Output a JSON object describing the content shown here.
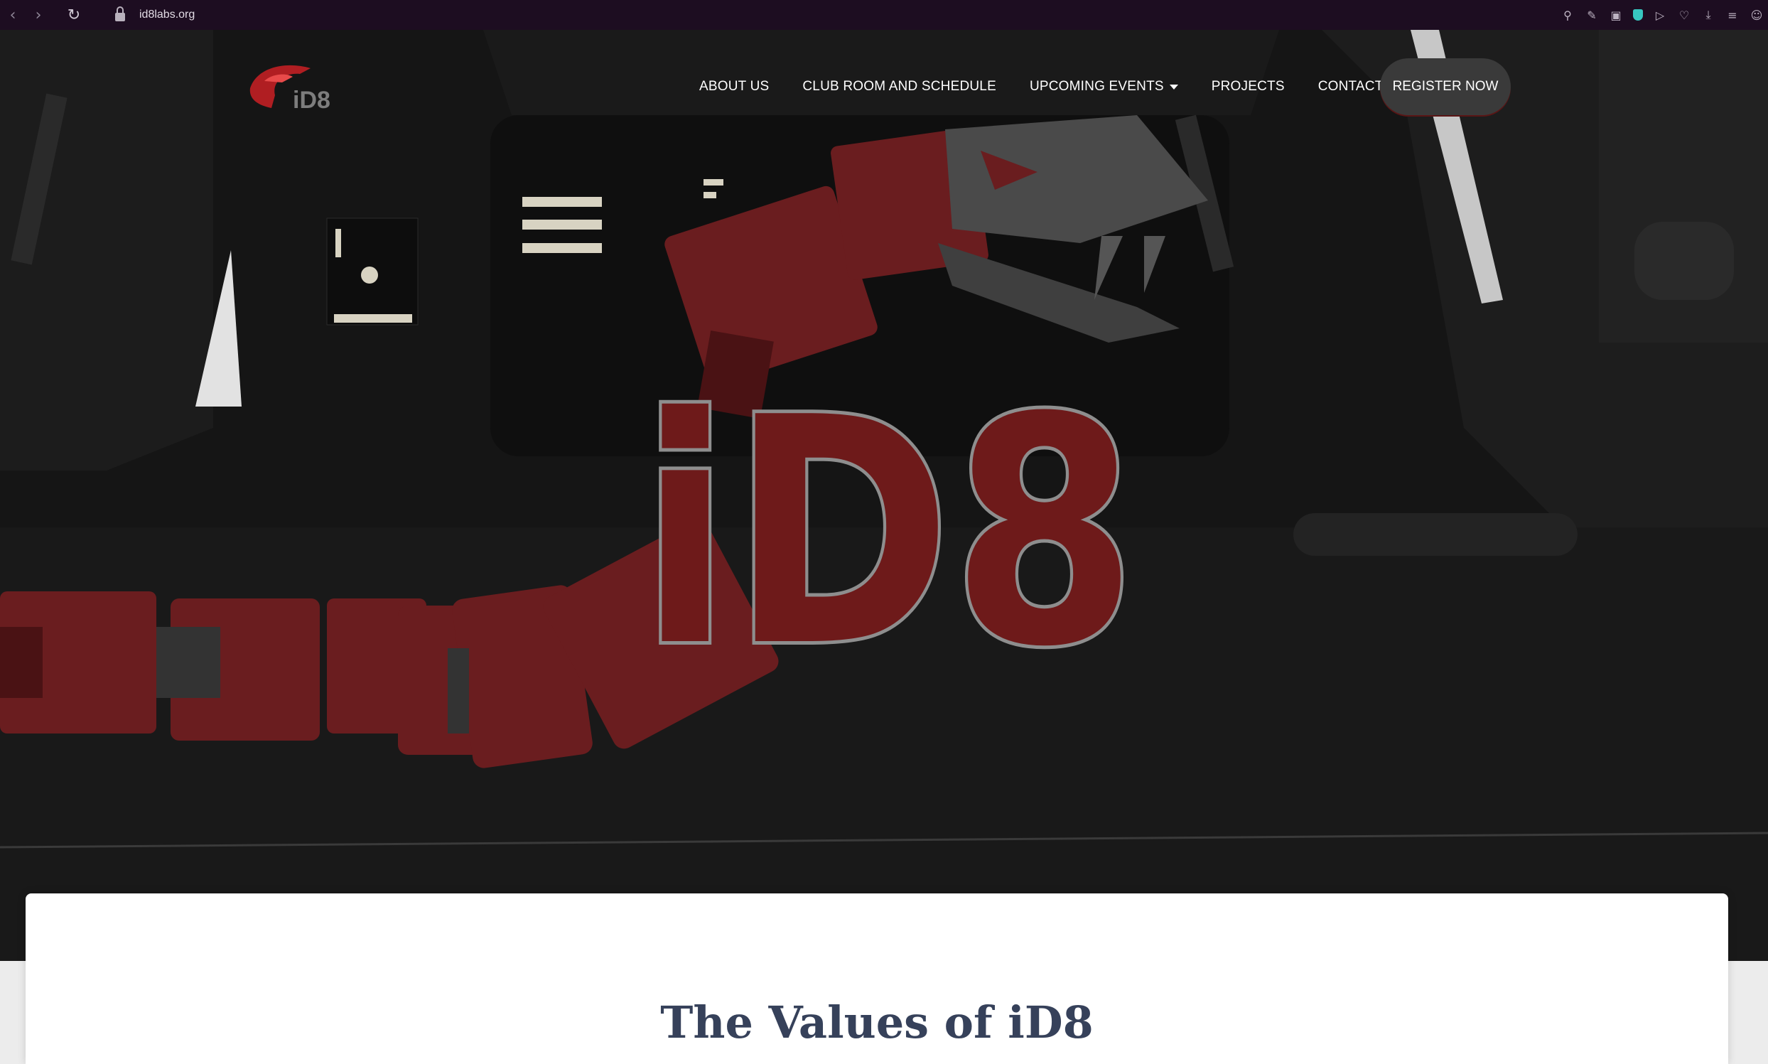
{
  "browser": {
    "url": "id8labs.org",
    "back_icon": "chevron-left-icon",
    "forward_icon": "chevron-right-icon",
    "reload_icon": "reload-icon",
    "tools": [
      "search-icon",
      "edit-icon",
      "camera-icon",
      "shield-icon",
      "send-icon",
      "heart-icon",
      "download-icon",
      "menu-icon",
      "profile-icon"
    ]
  },
  "brand": {
    "logo_text": "iD8",
    "accent": "#7a1a1a"
  },
  "nav": {
    "items": [
      {
        "label": "ABOUT US"
      },
      {
        "label": "CLUB ROOM AND SCHEDULE"
      },
      {
        "label": "UPCOMING EVENTS",
        "has_dropdown": true
      },
      {
        "label": "PROJECTS"
      },
      {
        "label": "CONTACT US"
      }
    ],
    "cta": "REGISTER NOW"
  },
  "hero": {
    "title": "iD8"
  },
  "section": {
    "heading": "The Values of iD8"
  }
}
